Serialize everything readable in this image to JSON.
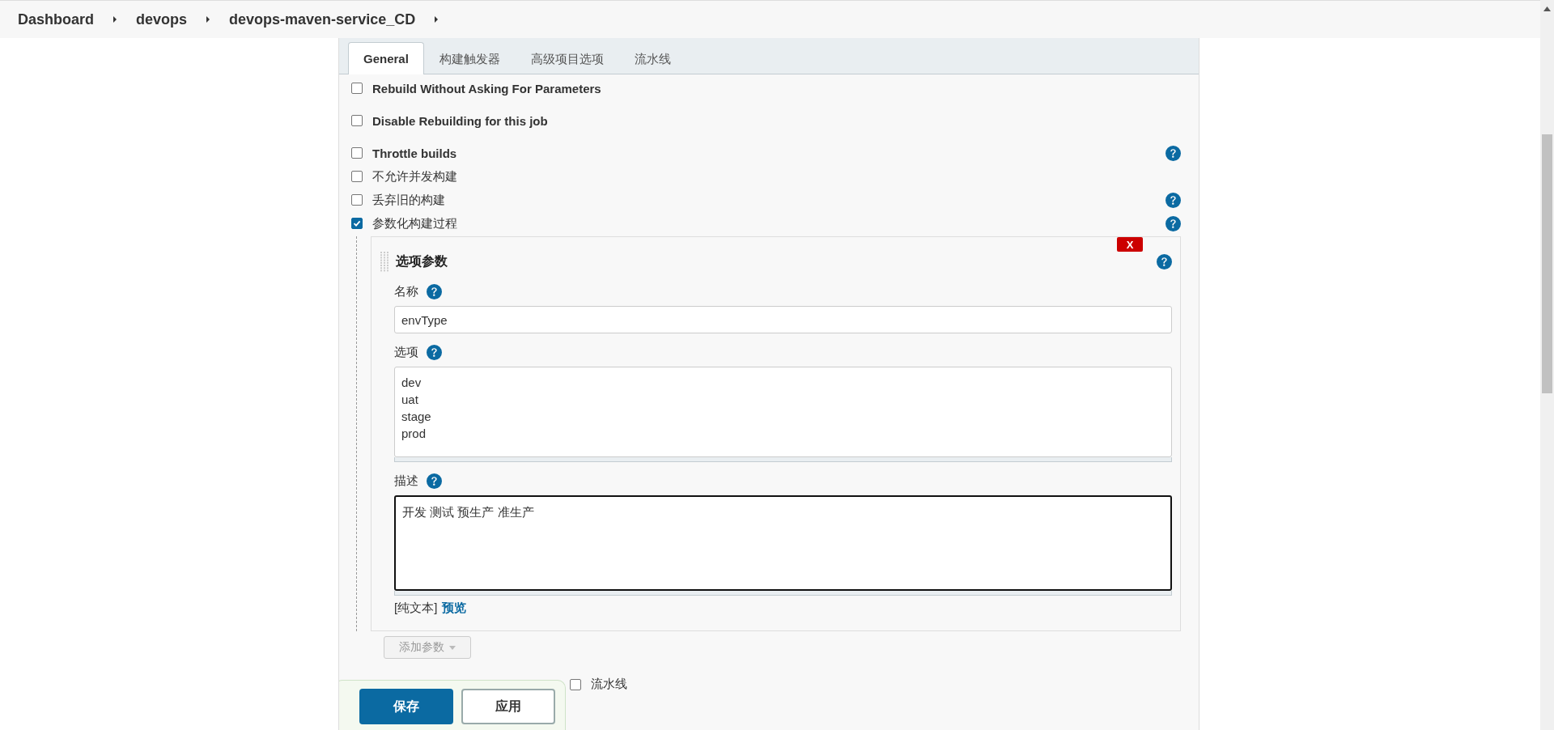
{
  "breadcrumb": [
    {
      "label": "Dashboard"
    },
    {
      "label": "devops"
    },
    {
      "label": "devops-maven-service_CD"
    }
  ],
  "tabs": [
    {
      "label": "General",
      "selected": true
    },
    {
      "label": "构建触发器",
      "selected": false
    },
    {
      "label": "高级项目选项",
      "selected": false
    },
    {
      "label": "流水线",
      "selected": false
    }
  ],
  "options": [
    {
      "label": "Rebuild Without Asking For Parameters",
      "checked": false,
      "help": false,
      "bold": true
    },
    {
      "label": "Disable Rebuilding for this job",
      "checked": false,
      "help": false,
      "bold": true
    },
    {
      "label": "Throttle builds",
      "checked": false,
      "help": true,
      "bold": true
    },
    {
      "label": "不允许并发构建",
      "checked": false,
      "help": false,
      "bold": false
    },
    {
      "label": "丢弃旧的构建",
      "checked": false,
      "help": true,
      "bold": false
    },
    {
      "label": "参数化构建过程",
      "checked": true,
      "help": true,
      "bold": false
    }
  ],
  "parameter": {
    "title": "选项参数",
    "delete_label": "X",
    "fields": [
      {
        "kind": "input",
        "label": "名称",
        "value": "envType"
      },
      {
        "kind": "textarea",
        "label": "选项",
        "value": "dev\nuat\nstage\nprod"
      },
      {
        "kind": "textarea",
        "label": "描述",
        "value": "开发 测试 预生产 准生产",
        "focused": true
      }
    ],
    "format_label": "[纯文本]",
    "preview_link": "预览"
  },
  "add_parameter_button": "添加参数",
  "partial_row": {
    "label": "流水线",
    "checked": false
  },
  "footer_buttons": [
    {
      "label": "保存",
      "kind": "primary"
    },
    {
      "label": "应用",
      "kind": "secondary"
    }
  ]
}
